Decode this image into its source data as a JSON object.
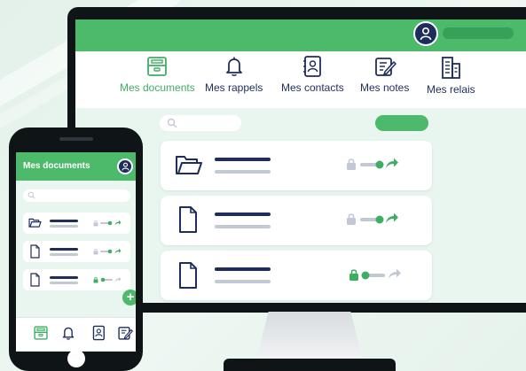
{
  "colors": {
    "accent_green": "#4db96a",
    "navy": "#1f2d5c",
    "gray_line": "#c2c9d4",
    "background": "#e9f5ef"
  },
  "desktop": {
    "nav": [
      {
        "label": "Mes documents",
        "icon": "archive-box-icon",
        "active": true
      },
      {
        "label": "Mes rappels",
        "icon": "bell-icon",
        "active": false
      },
      {
        "label": "Mes contacts",
        "icon": "contact-book-icon",
        "active": false
      },
      {
        "label": "Mes notes",
        "icon": "notepad-pencil-icon",
        "active": false
      },
      {
        "label": "Mes relais",
        "icon": "building-icon",
        "active": false
      }
    ],
    "documents": [
      {
        "icon": "folder-icon",
        "locked_state": "unlocked",
        "toggle": "on"
      },
      {
        "icon": "document-icon",
        "locked_state": "unlocked",
        "toggle": "on"
      },
      {
        "icon": "document-icon",
        "locked_state": "locked",
        "toggle": "off"
      }
    ]
  },
  "mobile": {
    "title": "Mes documents",
    "documents": [
      {
        "icon": "folder-icon"
      },
      {
        "icon": "document-icon"
      },
      {
        "icon": "document-icon"
      }
    ],
    "tabs": [
      {
        "icon": "archive-box-icon",
        "active": true
      },
      {
        "icon": "bell-icon",
        "active": false
      },
      {
        "icon": "contact-book-icon",
        "active": false
      },
      {
        "icon": "notepad-pencil-icon",
        "active": false
      }
    ]
  }
}
